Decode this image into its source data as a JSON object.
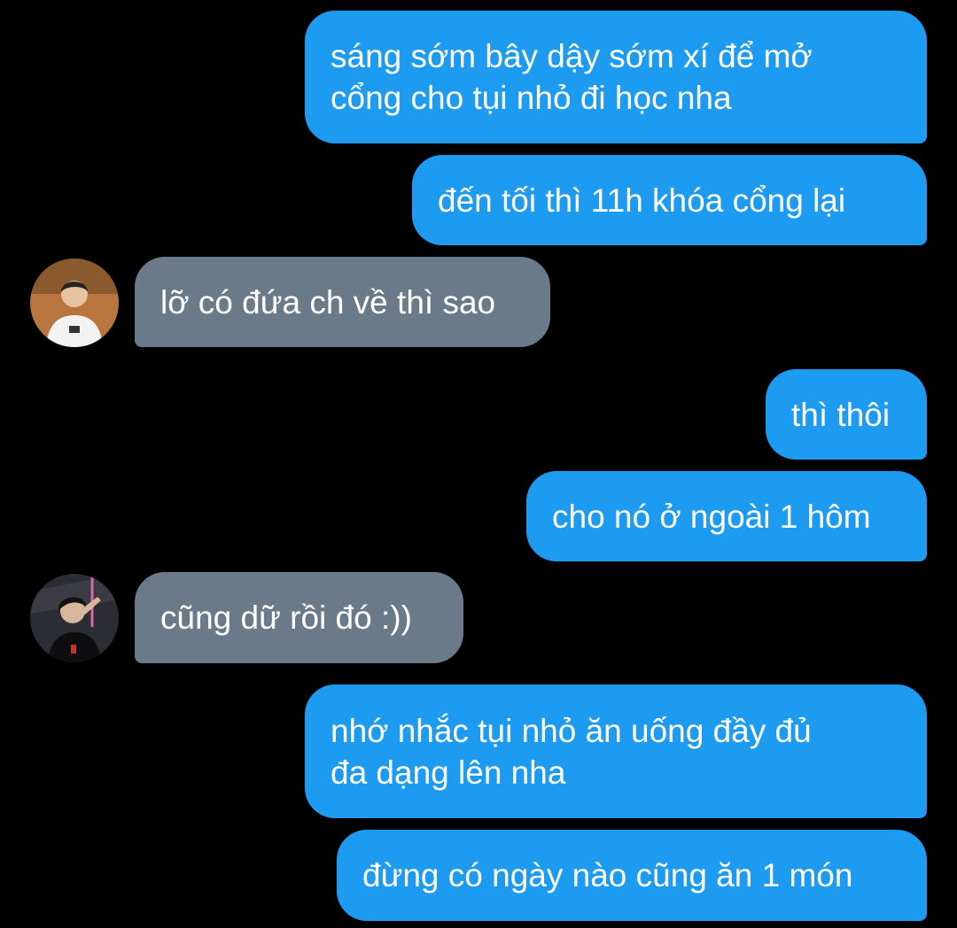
{
  "conversation": {
    "colors": {
      "background": "#000000",
      "sent_bubble": "#1d9bf0",
      "received_bubble": "#6b7a88",
      "text": "#ffffff"
    },
    "messages": [
      {
        "direction": "sent",
        "text": "sáng sớm bây dậy sớm xí để mở\ncổng cho tụi nhỏ đi học nha"
      },
      {
        "direction": "sent",
        "text": "đến tối thì 11h khóa cổng lại"
      },
      {
        "direction": "received",
        "avatar": "avatar-photo-1",
        "text": "lỡ có đứa ch về thì sao"
      },
      {
        "direction": "sent",
        "text": "thì thôi"
      },
      {
        "direction": "sent",
        "text": "cho nó ở ngoài 1 hôm"
      },
      {
        "direction": "received",
        "avatar": "avatar-photo-2",
        "text": "cũng dữ rồi đó :))"
      },
      {
        "direction": "sent",
        "text": "nhớ nhắc tụi nhỏ ăn uống đầy đủ\nđa dạng lên nha"
      },
      {
        "direction": "sent",
        "text": "đừng có ngày nào cũng ăn 1 món"
      }
    ]
  }
}
